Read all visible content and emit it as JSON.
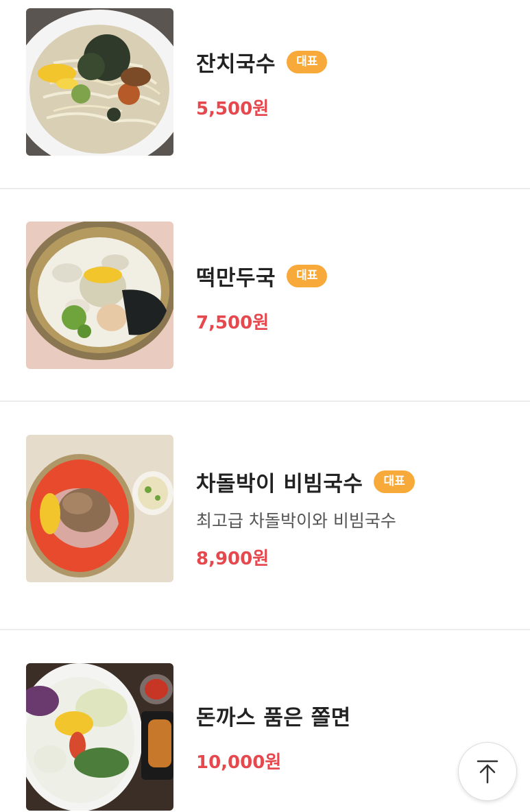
{
  "menu": {
    "items": [
      {
        "name": "잔치국수",
        "badge": "대표",
        "price": "5,500원",
        "image_icon": "janchi-guksu-photo"
      },
      {
        "name": "떡만두국",
        "badge": "대표",
        "price": "7,500원",
        "image_icon": "tteok-mandu-guk-photo"
      },
      {
        "name": "차돌박이 비빔국수",
        "badge": "대표",
        "description": "최고급 차돌박이와 비빔국수",
        "price": "8,900원",
        "image_icon": "chadol-bibim-guksu-photo"
      },
      {
        "name": "돈까스 품은 쫄면",
        "price": "10,000원",
        "image_icon": "donkatsu-jjolmyeon-photo"
      }
    ]
  },
  "scroll_top": {
    "icon": "arrow-up-to-top-icon"
  },
  "colors": {
    "badge": "#f7a93a",
    "price": "#e5484d",
    "divider": "#ececec"
  }
}
